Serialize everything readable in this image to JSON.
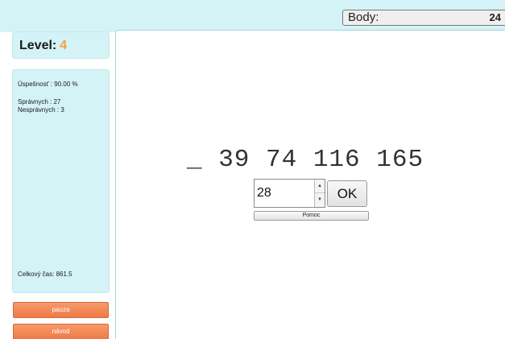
{
  "header": {
    "score_label": "Body:",
    "score_value": "24"
  },
  "level": {
    "label": "Level:",
    "value": "4"
  },
  "stats": {
    "success": "Úspešnosť : 90.00 %",
    "correct": "Správnych : 27",
    "wrong": "Nesprávnych : 3",
    "total_time": "Celkový čas: 861.5"
  },
  "buttons": {
    "pause": "pauza",
    "guide": "návod",
    "ok": "OK",
    "help": "Pomoc"
  },
  "puzzle": {
    "sequence": "_ 39 74 116 165",
    "answer_value": "28"
  },
  "icons": {
    "spin_up": "spin-up-icon",
    "spin_down": "spin-down-icon"
  },
  "colors": {
    "panel_bg": "#d4f3f6",
    "level_accent": "#f2a03d",
    "button_orange": "#ee7b45"
  }
}
